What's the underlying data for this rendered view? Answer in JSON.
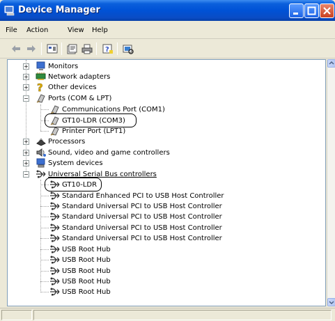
{
  "title": "Device Manager",
  "menu": [
    "File",
    "Action",
    "View",
    "Help"
  ],
  "toolbar": {
    "icons": [
      "back-arrow-icon",
      "forward-arrow-icon",
      "device-view-icon",
      "properties-icon",
      "print-icon",
      "help-icon",
      "scan-hardware-icon"
    ]
  },
  "tree": {
    "categories": [
      {
        "label": "Monitors",
        "expanded": false,
        "icon": "monitor-icon"
      },
      {
        "label": "Network adapters",
        "expanded": false,
        "icon": "network-adapter-icon"
      },
      {
        "label": "Other devices",
        "expanded": false,
        "icon": "question-device-icon"
      },
      {
        "label": "Ports (COM & LPT)",
        "expanded": true,
        "icon": "port-icon",
        "children": [
          "Communications Port (COM1)",
          "GT10-LDR (COM3)",
          "Printer Port (LPT1)"
        ]
      },
      {
        "label": "Processors",
        "expanded": false,
        "icon": "processor-icon"
      },
      {
        "label": "Sound, video and game controllers",
        "expanded": false,
        "icon": "sound-icon"
      },
      {
        "label": "System devices",
        "expanded": false,
        "icon": "system-device-icon"
      },
      {
        "label": "Universal Serial Bus controllers",
        "expanded": true,
        "icon": "usb-icon",
        "children": [
          "GT10-LDR",
          "Standard Enhanced PCI to USB Host Controller",
          "Standard Universal PCI to USB Host Controller",
          "Standard Universal PCI to USB Host Controller",
          "Standard Universal PCI to USB Host Controller",
          "Standard Universal PCI to USB Host Controller",
          "USB Root Hub",
          "USB Root Hub",
          "USB Root Hub",
          "USB Root Hub",
          "USB Root Hub"
        ]
      }
    ]
  },
  "expander": {
    "collapsed": "+",
    "expanded": "−"
  },
  "colors": {
    "titlebar": "#0052d6",
    "window": "#ece9d8",
    "highlight": "#000000"
  }
}
